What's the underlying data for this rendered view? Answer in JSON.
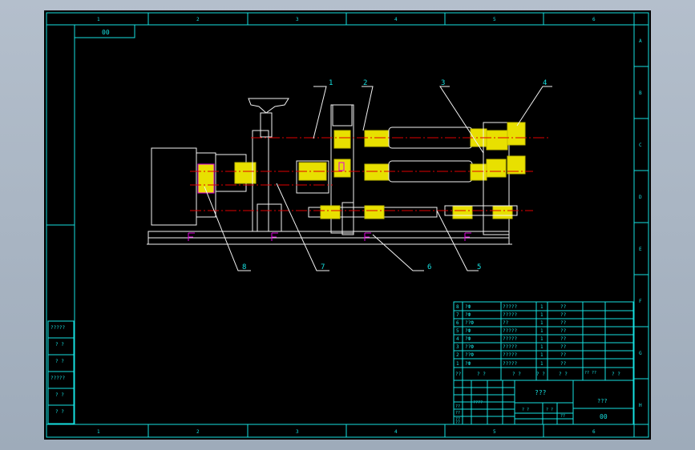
{
  "drawing": {
    "code_top": "00",
    "grid_top": [
      "1",
      "2",
      "3",
      "4",
      "5",
      "6"
    ],
    "grid_bottom": [
      "1",
      "2",
      "3",
      "4",
      "5",
      "6"
    ],
    "grid_right": [
      "A",
      "B",
      "C",
      "D",
      "E",
      "F",
      "G",
      "H"
    ],
    "part_callouts": [
      "1",
      "2",
      "3",
      "4",
      "5",
      "6",
      "7",
      "8"
    ]
  },
  "left_stamp": [
    "?????",
    "? ?",
    "? ?",
    "?????",
    "? ?",
    "? ?"
  ],
  "bom": {
    "rows": [
      {
        "no": "8",
        "name": "?Ф",
        "spec": "?????",
        "qty": "1",
        "mat": "??"
      },
      {
        "no": "7",
        "name": "?Ф",
        "spec": "?????",
        "qty": "1",
        "mat": "??"
      },
      {
        "no": "6",
        "name": "??Ф",
        "spec": "??",
        "qty": "1",
        "mat": "??"
      },
      {
        "no": "5",
        "name": "?Ф",
        "spec": "?????",
        "qty": "1",
        "mat": "??"
      },
      {
        "no": "4",
        "name": "?Ф",
        "spec": "?????",
        "qty": "1",
        "mat": "??"
      },
      {
        "no": "3",
        "name": "??Ф",
        "spec": "?????",
        "qty": "1",
        "mat": "??"
      },
      {
        "no": "2",
        "name": "??Ф",
        "spec": "?????",
        "qty": "1",
        "mat": "??"
      },
      {
        "no": "1",
        "name": "?Ф",
        "spec": "?????",
        "qty": "1",
        "mat": "??"
      }
    ],
    "header": [
      "??",
      "? ?",
      "? ?",
      "? ?",
      "? ?",
      "?? ??",
      "? ?"
    ]
  },
  "title_block": {
    "name": "???",
    "company": "???",
    "code": "00",
    "row_labels": [
      "??",
      "??",
      "??",
      "??"
    ],
    "marks": [
      "????",
      "? ?",
      "? ?",
      "??"
    ]
  }
}
